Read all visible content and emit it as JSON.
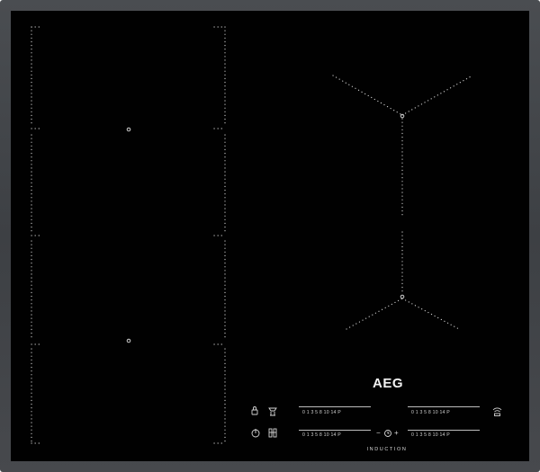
{
  "brand": {
    "logo": "AEG",
    "product_label": "INDUCTION"
  },
  "control_panel": {
    "power_scale_label": "0 1 3 5  8 10  14 P",
    "timer": {
      "minus": "−",
      "plus": "+"
    },
    "icons": {
      "lock": "lock-icon",
      "hob2hood": "hob2hood-icon",
      "power": "power-icon",
      "bridge": "bridge-icon",
      "timer": "timer-icon",
      "wifi": "wifi-icon"
    }
  },
  "colors": {
    "frame": "#45484c",
    "glass": "#010101",
    "markings": "#d0d0d0"
  }
}
